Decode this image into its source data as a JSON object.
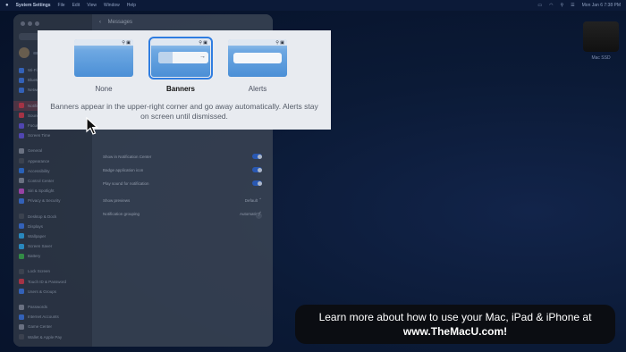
{
  "menubar": {
    "app_name": "System Settings",
    "items": [
      "File",
      "Edit",
      "View",
      "Window",
      "Help"
    ],
    "clock": "Mon Jan 6  7:38 PM"
  },
  "desktop": {
    "drive_label": "Mac SSD"
  },
  "settings_window": {
    "title": "Messages",
    "sidebar_items": [
      "Wi-Fi",
      "Bluetooth",
      "Network",
      "Notifications",
      "Sound",
      "Focus",
      "Screen Time",
      "General",
      "Appearance",
      "Accessibility",
      "Control Center",
      "Siri & Spotlight",
      "Privacy & Security",
      "Desktop & Dock",
      "Displays",
      "Wallpaper",
      "Screen Saver",
      "Battery",
      "Lock Screen",
      "Touch ID & Password",
      "Users & Groups",
      "Passwords",
      "Internet Accounts",
      "Game Center",
      "Wallet & Apple Pay"
    ],
    "rows": {
      "show_in_nc": "Show in Notification Center",
      "badge_icon": "Badge application icon",
      "play_sound": "Play sound for notification",
      "show_previews": "Show previews",
      "show_previews_value": "Default",
      "grouping": "Notification grouping",
      "grouping_value": "Automatic"
    },
    "help": "?"
  },
  "alert_style": {
    "options": [
      {
        "label": "None",
        "selected": false
      },
      {
        "label": "Banners",
        "selected": true
      },
      {
        "label": "Alerts",
        "selected": false
      }
    ],
    "description": "Banners appear in the upper-right corner and go away automatically. Alerts stay on screen until dismissed.",
    "accent_color": "#2f7de1"
  },
  "promo": {
    "line1": "Learn more about how to use your Mac, iPad & iPhone at",
    "line2": "www.TheMacU.com!"
  },
  "icons": {
    "search": "search-icon",
    "notification_center": "notification-center-icon",
    "arrow": "arrow-right-icon"
  }
}
